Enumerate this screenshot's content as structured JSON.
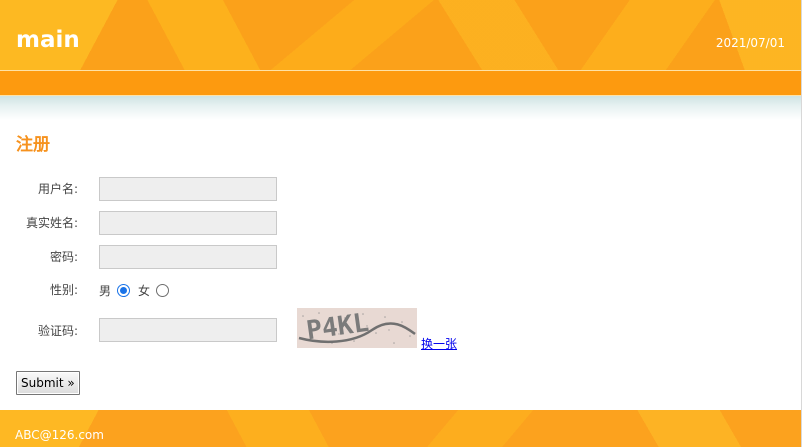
{
  "header": {
    "title": "main",
    "date": "2021/07/01"
  },
  "form": {
    "title": "注册",
    "fields": {
      "username": {
        "label": "用户名:",
        "value": ""
      },
      "realname": {
        "label": "真实姓名:",
        "value": ""
      },
      "password": {
        "label": "密码:",
        "value": ""
      },
      "gender": {
        "label": "性别:",
        "options": [
          "男",
          "女"
        ],
        "selected": "男"
      },
      "captcha": {
        "label": "验证码:",
        "value": "",
        "image_text": "P4KL",
        "refresh_label": "换一张"
      }
    },
    "submit_label": "Submit »"
  },
  "footer": {
    "email": "ABC@126.com"
  },
  "colors": {
    "brand_orange": "#fba11a",
    "title_orange": "#f6921e",
    "radio_blue": "#1a73e8"
  }
}
